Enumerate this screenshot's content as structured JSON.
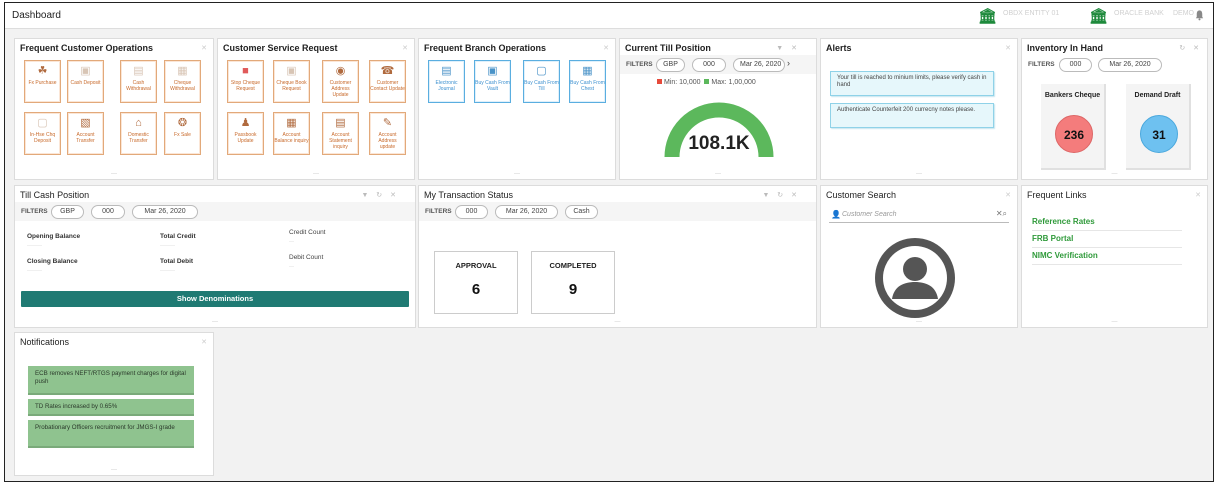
{
  "header": {
    "title": "Dashboard",
    "dim_text_1": "OBDX ENTITY 01",
    "dim_text_2": "ORACLE BANK",
    "dim_text_3": "DEMO",
    "notifications_icon": "bell-icon",
    "logo_icon": "bank-building-icon"
  },
  "frequent_customer_operations": {
    "title": "Frequent Customer Operations",
    "tiles": [
      {
        "label": "Fx Purchase",
        "icon": "fx-icon"
      },
      {
        "label": "Cash Deposit",
        "icon": "cash-deposit-icon"
      },
      {
        "label": "Cash Withdrawal",
        "icon": "cash-withdrawal-icon"
      },
      {
        "label": "Cheque Withdrawal",
        "icon": "cheque-icon"
      },
      {
        "label": "In-Hse Chq Deposit",
        "icon": "cheque-deposit-icon"
      },
      {
        "label": "Account Transfer",
        "icon": "transfer-icon"
      },
      {
        "label": "Domestic Transfer",
        "icon": "bank-icon"
      },
      {
        "label": "Fx Sale",
        "icon": "fx-sale-icon"
      }
    ]
  },
  "customer_service_request": {
    "title": "Customer Service Request",
    "tiles": [
      {
        "label": "Stop Cheque Request",
        "icon": "stop-icon"
      },
      {
        "label": "Cheque Book Request",
        "icon": "cheque-book-icon"
      },
      {
        "label": "Customer Address Update",
        "icon": "location-icon"
      },
      {
        "label": "Customer Contact Update",
        "icon": "phone-icon"
      },
      {
        "label": "Passbook Update",
        "icon": "passbook-icon"
      },
      {
        "label": "Account Balance inquiry",
        "icon": "balance-icon"
      },
      {
        "label": "Account Statement inquiry",
        "icon": "statement-icon"
      },
      {
        "label": "Account Address update",
        "icon": "address-icon"
      }
    ]
  },
  "frequent_branch_operations": {
    "title": "Frequent Branch Operations",
    "tiles": [
      {
        "label": "Electronic Journal",
        "icon": "journal-icon"
      },
      {
        "label": "Buy Cash From Vault",
        "icon": "vault-icon"
      },
      {
        "label": "Buy Cash From Till",
        "icon": "till-icon"
      },
      {
        "label": "Buy Cash From Chest",
        "icon": "chest-icon"
      }
    ]
  },
  "current_till_position": {
    "title": "Current Till Position",
    "filters_label": "FILTERS",
    "currency": "GBP",
    "branch": "000",
    "date": "Mar 26, 2020",
    "min_label": "Min: 10,000",
    "max_label": "Max: 1,00,000",
    "gauge_value": "108.1K",
    "min_color": "#e64a3b",
    "max_color": "#5cb85c",
    "gauge_color": "#5cb85c"
  },
  "alerts": {
    "title": "Alerts",
    "items": [
      "Your till is reached to minium limits, please verify cash in hand",
      "Authenticate Counterfeit 200 currecny notes please."
    ]
  },
  "inventory_in_hand": {
    "title": "Inventory In Hand",
    "filters_label": "FILTERS",
    "branch": "000",
    "date": "Mar 26, 2020",
    "cards": [
      {
        "label": "Bankers Cheque",
        "value": "236",
        "color": "#f47c7c"
      },
      {
        "label": "Demand Draft",
        "value": "31",
        "color": "#6ec1f0"
      }
    ]
  },
  "till_cash_position": {
    "title": "Till Cash Position",
    "filters_label": "FILTERS",
    "currency": "GBP",
    "branch": "000",
    "date": "Mar 26, 2020",
    "opening_balance_label": "Opening Balance",
    "closing_balance_label": "Closing Balance",
    "total_credit_label": "Total Credit",
    "total_debit_label": "Total Debit",
    "credit_count_label": "Credit Count",
    "debit_count_label": "Debit Count",
    "button_label": "Show Denominations"
  },
  "my_transaction_status": {
    "title": "My Transaction Status",
    "filters_label": "FILTERS",
    "branch": "000",
    "date": "Mar 26, 2020",
    "type": "Cash",
    "approval_label": "APPROVAL",
    "approval_value": "6",
    "completed_label": "COMPLETED",
    "completed_value": "9"
  },
  "customer_search": {
    "title": "Customer Search",
    "placeholder": "Customer Search"
  },
  "frequent_links": {
    "title": "Frequent Links",
    "links": [
      "Reference Rates",
      "FRB Portal",
      "NIMC Verification"
    ]
  },
  "notifications": {
    "title": "Notifications",
    "items": [
      "ECB removes NEFT/RTGS payment charges for digital push",
      "TD Rates increased by 0.65%",
      "Probationary Officers recruitment for JMGS-I grade"
    ]
  }
}
